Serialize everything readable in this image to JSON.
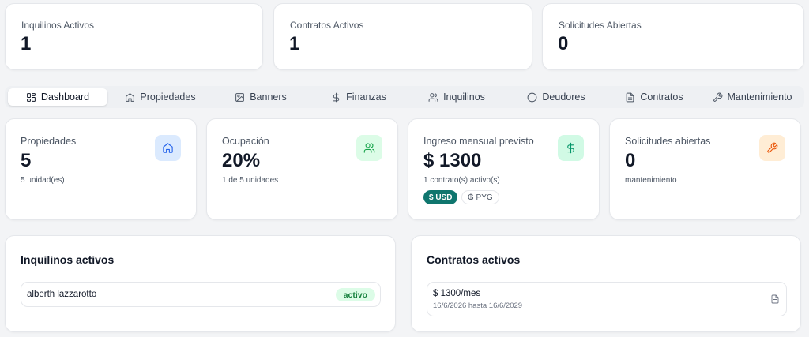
{
  "summary": [
    {
      "label": "Inquilinos Activos",
      "value": "1"
    },
    {
      "label": "Contratos Activos",
      "value": "1"
    },
    {
      "label": "Solicitudes Abiertas",
      "value": "0"
    }
  ],
  "tabs": [
    {
      "label": "Dashboard",
      "icon": "dashboard-grid-icon",
      "active": true
    },
    {
      "label": "Propiedades",
      "icon": "home-icon"
    },
    {
      "label": "Banners",
      "icon": "image-icon"
    },
    {
      "label": "Finanzas",
      "icon": "dollar-icon"
    },
    {
      "label": "Inquilinos",
      "icon": "users-icon"
    },
    {
      "label": "Deudores",
      "icon": "alert-circle-icon"
    },
    {
      "label": "Contratos",
      "icon": "file-icon"
    },
    {
      "label": "Mantenimiento",
      "icon": "wrench-icon"
    }
  ],
  "stats": [
    {
      "label": "Propiedades",
      "value": "5",
      "sub": "5 unidad(es)",
      "icon": "home-icon",
      "color": "#2563eb",
      "bg": "#dbeafe"
    },
    {
      "label": "Ocupación",
      "value": "20%",
      "sub": "1 de 5 unidades",
      "icon": "users-icon",
      "color": "#16a34a",
      "bg": "#dcfce7"
    },
    {
      "label": "Ingreso mensual previsto",
      "value": "$ 1300",
      "sub": "1 contrato(s) activo(s)",
      "icon": "dollar-icon",
      "color": "#059669",
      "bg": "#d1fae5"
    },
    {
      "label": "Solicitudes abiertas",
      "value": "0",
      "sub": "mantenimiento",
      "icon": "wrench-icon",
      "color": "#ea580c",
      "bg": "#ffedd5"
    }
  ],
  "currency": {
    "usd": "$ USD",
    "pyg": "₲ PYG",
    "usd_color": "#0f766e"
  },
  "tenants_panel": {
    "title": "Inquilinos activos",
    "items": [
      {
        "name": "alberth lazzarotto",
        "status": "activo"
      }
    ]
  },
  "contracts_panel": {
    "title": "Contratos activos",
    "items": [
      {
        "amount": "$ 1300/mes",
        "dates": "16/6/2026 hasta 16/6/2029"
      }
    ]
  }
}
